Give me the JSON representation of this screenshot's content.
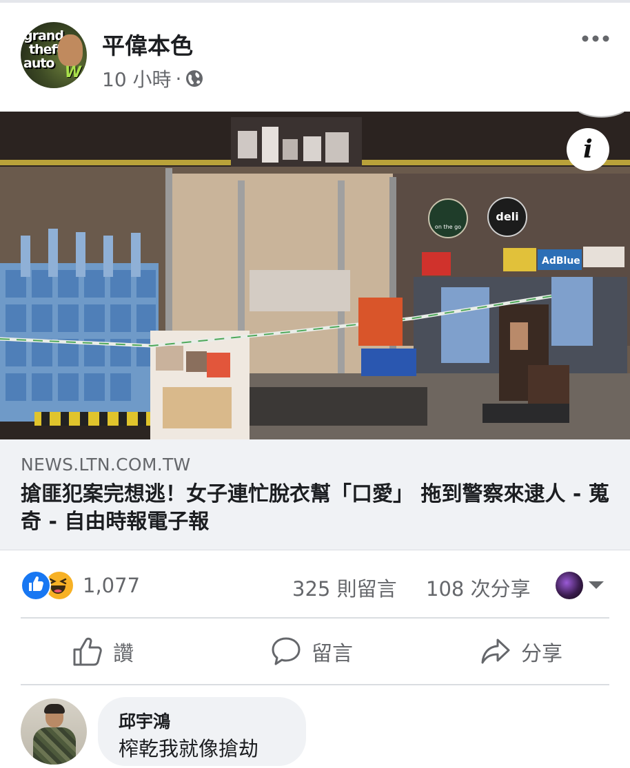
{
  "post": {
    "page_name": "平偉本色",
    "time": "10 小時",
    "separator": "·"
  },
  "link": {
    "domain": "NEWS.LTN.COM.TW",
    "title": "搶匪犯案完想逃！女子連忙脫衣幫「口愛」 拖到警察來逮人 - 蒐奇 - 自由時報電子報"
  },
  "photo": {
    "signs": [
      "on the go",
      "deli",
      "AdBlue"
    ]
  },
  "stats": {
    "reaction_count": "1,077",
    "comment_count": "325 則留言",
    "share_count": "108 次分享"
  },
  "actions": {
    "like_label": "讚",
    "comment_label": "留言",
    "share_label": "分享"
  },
  "comment": {
    "author": "邱宇鴻",
    "text": "榨乾我就像搶劫"
  },
  "colors": {
    "like_blue": "#1877f2",
    "haha_yellow": "#f7b125",
    "secondary_text": "#65676b",
    "preview_bg": "#f0f2f5"
  },
  "icons": [
    "globe-icon",
    "more-icon",
    "info-icon",
    "like-reaction-icon",
    "haha-reaction-icon",
    "caret-down-icon",
    "thumbs-up-icon",
    "comment-icon",
    "share-icon"
  ]
}
